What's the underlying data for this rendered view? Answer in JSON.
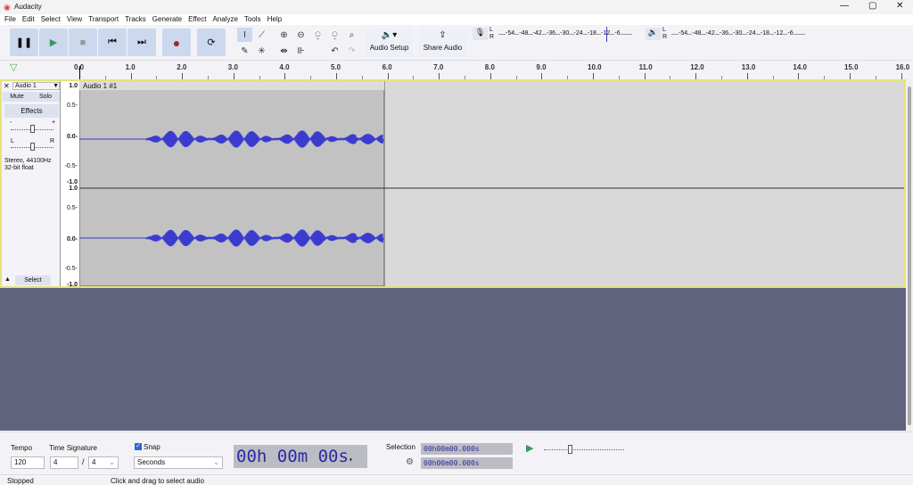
{
  "window": {
    "title": "Audacity"
  },
  "menu": [
    "File",
    "Edit",
    "Select",
    "View",
    "Transport",
    "Tracks",
    "Generate",
    "Effect",
    "Analyze",
    "Tools",
    "Help"
  ],
  "toolbar": {
    "audio_setup": "Audio Setup",
    "share_audio": "Share Audio",
    "meter_ticks": [
      "-54",
      "-48",
      "-42",
      "-36",
      "-30",
      "-24",
      "-18",
      "-12",
      "-6"
    ],
    "lr": [
      "L",
      "R"
    ]
  },
  "ruler": {
    "ticks": [
      "0.0",
      "1.0",
      "2.0",
      "3.0",
      "4.0",
      "5.0",
      "6.0",
      "7.0",
      "8.0",
      "9.0",
      "10.0",
      "11.0",
      "12.0",
      "13.0",
      "14.0",
      "15.0",
      "16.0"
    ]
  },
  "track": {
    "name": "Audio 1",
    "mute": "Mute",
    "solo": "Solo",
    "effects": "Effects",
    "gain_minus": "-",
    "gain_plus": "+",
    "pan_l": "L",
    "pan_r": "R",
    "info1": "Stereo, 44100Hz",
    "info2": "32-bit float",
    "select": "Select",
    "clip_name": "Audio 1 #1",
    "scale": [
      "1.0",
      "0.5-",
      "0.0-",
      "-0.5-",
      "-1.0"
    ],
    "wave_color": "#3b3bcf"
  },
  "bottom": {
    "tempo_label": "Tempo",
    "tempo": "120",
    "timesig_label": "Time Signature",
    "ts_num": "4",
    "ts_den": "4",
    "snap_label": "Snap",
    "snap_checked": true,
    "snap_unit": "Seconds",
    "time": {
      "h": "00",
      "hl": "h",
      "m": "00",
      "ml": "m",
      "s": "00",
      "sl": "s"
    },
    "selection_label": "Selection",
    "sel_start": "00h00m00.000s",
    "sel_end": "00h00m00.000s"
  },
  "status": {
    "state": "Stopped",
    "hint": "Click and drag to select audio"
  }
}
